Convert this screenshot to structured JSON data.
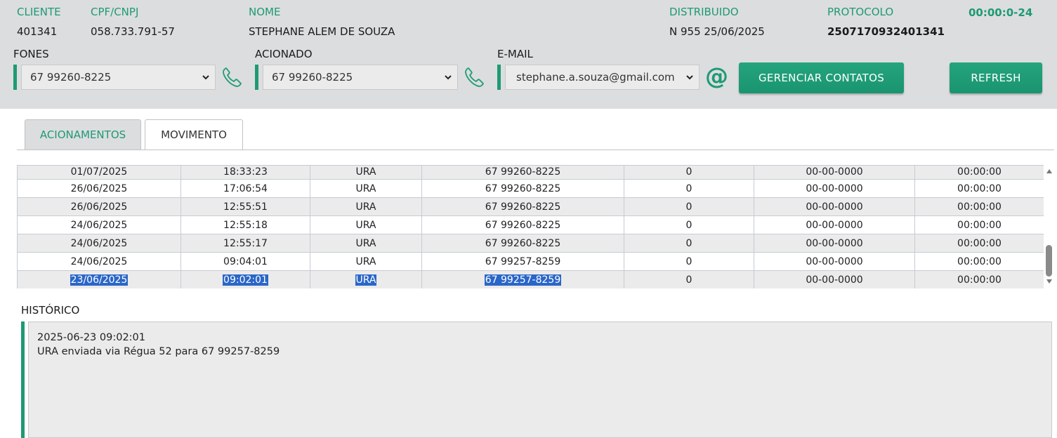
{
  "header": {
    "cliente": {
      "label": "CLIENTE",
      "value": "401341"
    },
    "cpf": {
      "label": "CPF/CNPJ",
      "value": "058.733.791-57"
    },
    "nome": {
      "label": "NOME",
      "value": "STEPHANE ALEM DE SOUZA"
    },
    "distribuido": {
      "label": "DISTRIBUIDO",
      "value": "N 955 25/06/2025"
    },
    "protocolo": {
      "label": "PROTOCOLO",
      "value": "2507170932401341"
    },
    "timer": "00:00:0-24"
  },
  "contacts": {
    "fones": {
      "label": "FONES",
      "selected": "67 99260-8225",
      "icon": "phone-icon"
    },
    "acionado": {
      "label": "ACIONADO",
      "selected": "67 99260-8225",
      "icon": "phone-icon"
    },
    "email": {
      "label": "E-MAIL",
      "selected": "stephane.a.souza@gmail.com",
      "icon": "at-icon",
      "icon_glyph": "@"
    },
    "manage_button": "GERENCIAR CONTATOS",
    "refresh_button": "REFRESH"
  },
  "tabs": [
    {
      "label": "ACIONAMENTOS",
      "active": true
    },
    {
      "label": "MOVIMENTO",
      "active": false
    }
  ],
  "grid": {
    "rows": [
      [
        "01/07/2025",
        "18:33:23",
        "URA",
        "67 99260-8225",
        "0",
        "00-00-0000",
        "00:00:00"
      ],
      [
        "26/06/2025",
        "17:06:54",
        "URA",
        "67 99260-8225",
        "0",
        "00-00-0000",
        "00:00:00"
      ],
      [
        "26/06/2025",
        "12:55:51",
        "URA",
        "67 99260-8225",
        "0",
        "00-00-0000",
        "00:00:00"
      ],
      [
        "24/06/2025",
        "12:55:18",
        "URA",
        "67 99260-8225",
        "0",
        "00-00-0000",
        "00:00:00"
      ],
      [
        "24/06/2025",
        "12:55:17",
        "URA",
        "67 99260-8225",
        "0",
        "00-00-0000",
        "00:00:00"
      ],
      [
        "24/06/2025",
        "09:04:01",
        "URA",
        "67 99257-8259",
        "0",
        "00-00-0000",
        "00:00:00"
      ],
      [
        "23/06/2025",
        "09:02:01",
        "URA",
        "67 99257-8259",
        "0",
        "00-00-0000",
        "00:00:00"
      ]
    ],
    "selected_row": 6
  },
  "historico": {
    "label": "HISTÓRICO",
    "line1": "2025-06-23 09:02:01",
    "line2": "URA enviada via Régua 52 para 67 99257-8259"
  }
}
